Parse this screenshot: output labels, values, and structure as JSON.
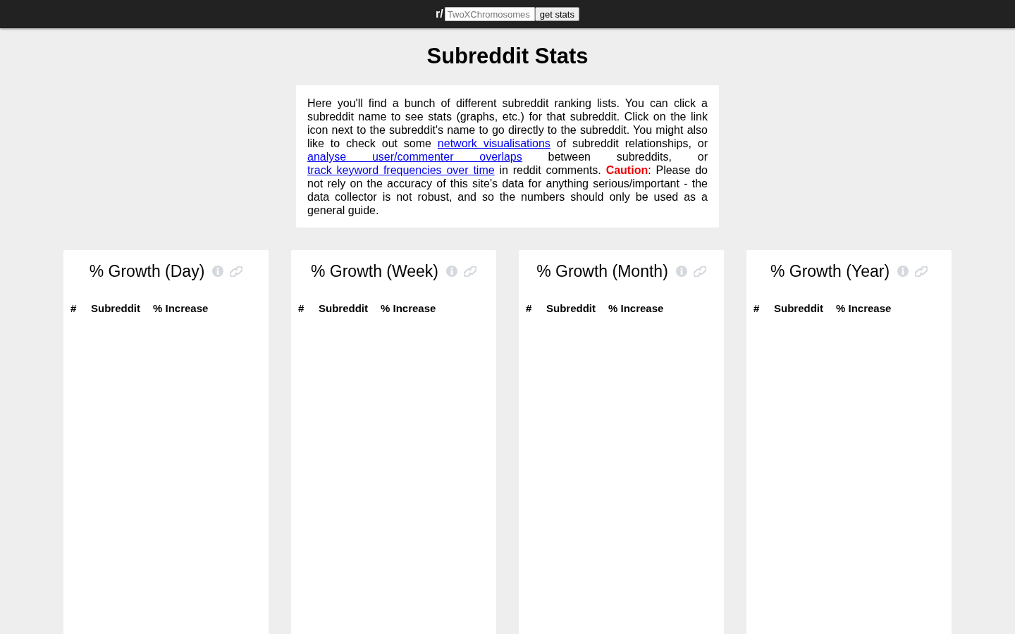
{
  "top_bar": {
    "prefix": "r/",
    "search": {
      "placeholder": "TwoXChromosomes"
    },
    "button": "get stats"
  },
  "title": "Subreddit Stats",
  "intro": {
    "segments": [
      {
        "kind": "text",
        "text": "Here you'll find a bunch of different subreddit ranking lists. You can click a subreddit name to see stats (graphs, etc.) for that subreddit. Click on the link icon next to the subreddit's name to go directly to the subreddit. You might also like to check out some "
      },
      {
        "kind": "link",
        "text": "network visualisations"
      },
      {
        "kind": "text",
        "text": " of subreddit relationships, or "
      },
      {
        "kind": "link",
        "text": "analyse user/commenter overlaps"
      },
      {
        "kind": "text",
        "text": " between subreddits, or "
      },
      {
        "kind": "link",
        "text": "track keyword frequencies over time"
      },
      {
        "kind": "text",
        "text": " in reddit comments. "
      },
      {
        "kind": "caution",
        "text": "Caution"
      },
      {
        "kind": "text",
        "text": ": Please do not rely on the accuracy of this site's data for anything serious/important - the data collector is not robust, and so the numbers should only be used as a general guide."
      }
    ]
  },
  "panels": [
    {
      "title": "% Growth (Day)",
      "columns": [
        "#",
        "Subreddit",
        "% Increase"
      ]
    },
    {
      "title": "% Growth (Week)",
      "columns": [
        "#",
        "Subreddit",
        "% Increase"
      ]
    },
    {
      "title": "% Growth (Month)",
      "columns": [
        "#",
        "Subreddit",
        "% Increase"
      ]
    },
    {
      "title": "% Growth (Year)",
      "columns": [
        "#",
        "Subreddit",
        "% Increase"
      ]
    }
  ]
}
